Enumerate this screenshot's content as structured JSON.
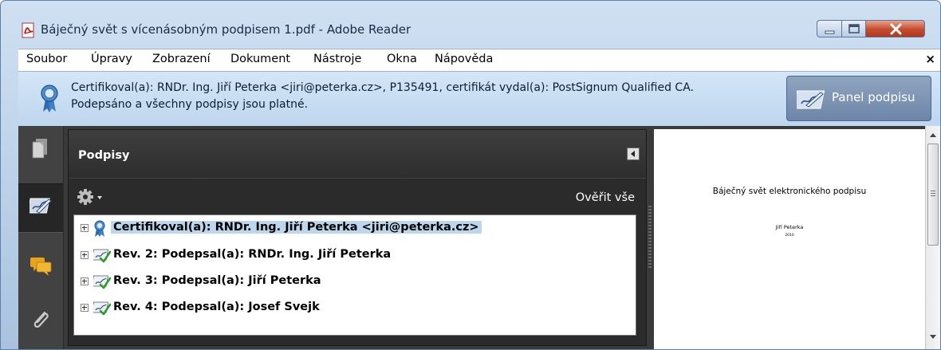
{
  "window": {
    "title": "Báječný svět s vícenásobným podpisem 1.pdf - Adobe Reader",
    "app_icon": "pdf-icon",
    "controls": [
      "minimize-icon",
      "maximize-icon",
      "close-icon"
    ]
  },
  "menu": {
    "items": [
      "Soubor",
      "Úpravy",
      "Zobrazení",
      "Dokument",
      "Nástroje",
      "Okna",
      "Nápověda"
    ],
    "close_label": "×"
  },
  "banner": {
    "icon": "certified-ribbon-icon",
    "line1": "Certifikoval(a): RNDr. Ing. Jiří Peterka <jiri@peterka.cz>, P135491, certifikát vydal(a): PostSignum Qualified CA.",
    "line2": "Podepsáno a všechny podpisy jsou platné.",
    "panel_button_label": "Panel podpisu"
  },
  "sidebar": {
    "tabs": [
      "pages-icon",
      "signatures-icon",
      "comments-icon",
      "attachments-icon"
    ],
    "active_index": 1
  },
  "signatures_panel": {
    "title": "Podpisy",
    "verify_all_label": "Ověřit vše",
    "rows": [
      {
        "label": "Certifikoval(a): RNDr. Ing. Jiří Peterka <jiri@peterka.cz>",
        "icon": "certified-ribbon-icon",
        "selected": true
      },
      {
        "label": "Rev. 2: Podepsal(a): RNDr. Ing. Jiří Peterka",
        "icon": "valid-signature-icon",
        "selected": false
      },
      {
        "label": "Rev. 3: Podepsal(a): Jiří Peterka",
        "icon": "valid-signature-icon",
        "selected": false
      },
      {
        "label": "Rev. 4: Podepsal(a): Josef Svejk",
        "icon": "valid-signature-icon",
        "selected": false
      }
    ]
  },
  "document": {
    "title": "Báječný svět elektronického podpisu",
    "author": "Jiří Peterka",
    "year": "2010"
  },
  "colors": {
    "banner_bg": "#c9def3",
    "panel_button": "#7b92b3",
    "workarea": "#3a3a3a",
    "selection": "#bcd6ee",
    "close_button": "#c44b2e"
  }
}
